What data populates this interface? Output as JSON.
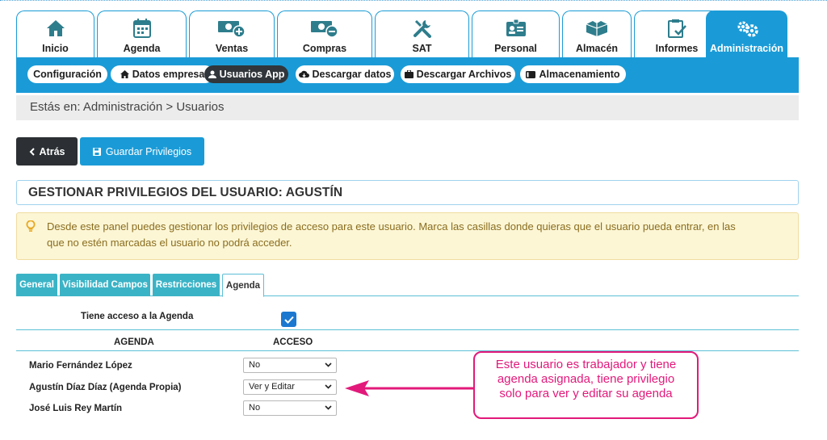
{
  "modules": [
    {
      "label": "Inicio",
      "icon": "home-icon"
    },
    {
      "label": "Agenda",
      "icon": "calendar-icon"
    },
    {
      "label": "Ventas",
      "icon": "money-plus-icon"
    },
    {
      "label": "Compras",
      "icon": "money-minus-icon"
    },
    {
      "label": "SAT",
      "icon": "tools-icon"
    },
    {
      "label": "Personal",
      "icon": "id-card-icon"
    },
    {
      "label": "Almacén",
      "icon": "boxes-icon"
    },
    {
      "label": "Informes",
      "icon": "clipboard-check-icon"
    },
    {
      "label": "Administración",
      "icon": "gears-icon",
      "active": true
    }
  ],
  "subnav": {
    "items": [
      {
        "label": "Configuración",
        "icon": ""
      },
      {
        "label": "Datos empresa",
        "icon": "home-icon"
      },
      {
        "label": "Usuarios App",
        "icon": "user-icon",
        "active": true
      },
      {
        "label": "Descargar datos",
        "icon": "cloud-download-icon"
      },
      {
        "label": "Descargar Archivos",
        "icon": "briefcase-icon"
      },
      {
        "label": "Almacenamiento",
        "icon": "hdd-icon"
      }
    ]
  },
  "breadcrumb": "Estás en: Administración > Usuarios",
  "buttons": {
    "back": "Atrás",
    "save": "Guardar Privilegios"
  },
  "panel_title": "GESTIONAR PRIVILEGIOS DEL USUARIO: AGUSTÍN",
  "alert": {
    "line1": "Desde este panel puedes gestionar los privilegios de acceso para este usuario. Marca las casillas donde quieras que el usuario pueda entrar, en las",
    "line2": "que no estén marcadas el usuario no podrá acceder."
  },
  "tabs": [
    {
      "label": "General"
    },
    {
      "label": "Visibilidad Campos"
    },
    {
      "label": "Restricciones"
    },
    {
      "label": "Agenda",
      "active": true
    }
  ],
  "agenda": {
    "access_label": "Tiene acceso a la Agenda",
    "access_checked": true,
    "col_agenda": "AGENDA",
    "col_access": "ACCESO",
    "rows": [
      {
        "name": "Mario Fernández López",
        "access": "No"
      },
      {
        "name": "Agustín Díaz Díaz (Agenda Propia)",
        "access": "Ver y Editar"
      },
      {
        "name": "José Luis Rey Martín",
        "access": "No"
      }
    ]
  },
  "annotation": {
    "line1": "Este usuario es trabajador y tiene",
    "line2": "agenda asignada, tiene privilegio",
    "line3": "solo para ver y editar su agenda"
  },
  "colors": {
    "primary": "#1a9bd7",
    "dark": "#2c3034",
    "tab": "#3bb3c6",
    "alert_bg": "#fcf6d5",
    "alert_text": "#8a6d1f",
    "annotation": "#e2197a"
  }
}
